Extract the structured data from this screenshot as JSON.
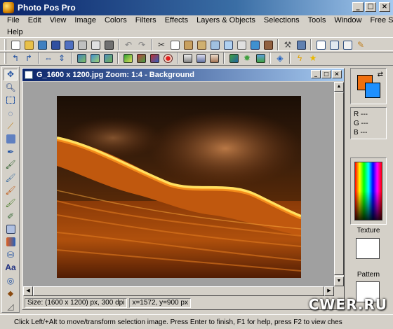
{
  "window": {
    "title": "Photo Pos Pro",
    "controls": [
      "_",
      "□",
      "×"
    ]
  },
  "menu": {
    "row1": [
      "File",
      "Edit",
      "View",
      "Image",
      "Colors",
      "Filters",
      "Effects",
      "Layers & Objects",
      "Selections",
      "Tools",
      "Window",
      "Free Stuff"
    ],
    "row2": [
      "Help"
    ]
  },
  "document": {
    "title": "G_1600 x 1200.jpg  Zoom: 1:4 - Background",
    "size_status": "Size: (1600 x 1200) px, 300 dpi",
    "coord_status": "x=1572, y=900 px"
  },
  "rgb": {
    "r": "R ---",
    "g": "G ---",
    "b": "B ---"
  },
  "colors": {
    "foreground": "#f07010",
    "background": "#1e90ff"
  },
  "panels": {
    "texture_label": "Texture",
    "pattern_label": "Pattern"
  },
  "status": {
    "text": "Click Left/+Alt to move/transform selection image. Press Enter to finish, F1 for help, press F2 to view ches"
  },
  "watermark": "CWER.RU"
}
